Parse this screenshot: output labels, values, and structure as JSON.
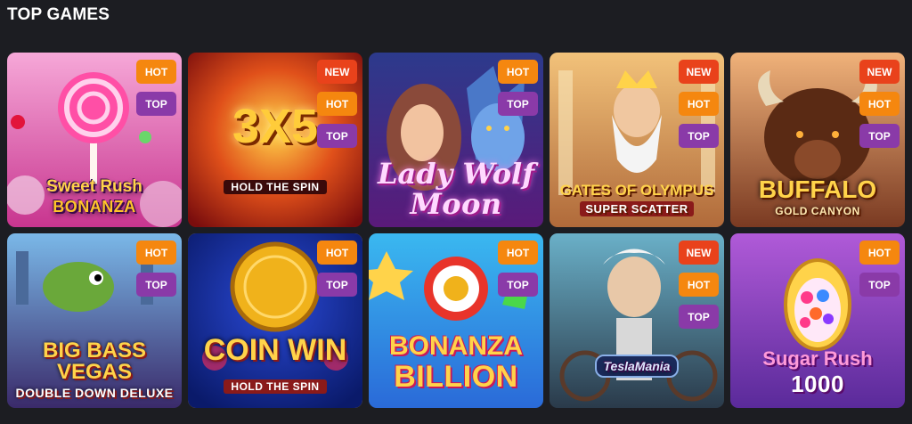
{
  "section": {
    "title": "TOP GAMES"
  },
  "colors": {
    "hot": "#f5870f",
    "new": "#e9421b",
    "top": "#8a3aa8",
    "selected_outline": "#f0b21b"
  },
  "games": [
    {
      "name": "Sweet Rush Bonanza",
      "title_line1": "Sweet Rush",
      "title_line2": "BONANZA",
      "badges": [
        "HOT",
        "TOP"
      ]
    },
    {
      "name": "3x5 Hold the Spin",
      "title_line1": "3X5",
      "title_line2": "HOLD THE SPIN",
      "badges": [
        "NEW",
        "HOT",
        "TOP"
      ]
    },
    {
      "name": "Lady Wolf Moon",
      "title_line1": "Lady Wolf",
      "title_line2": "Moon",
      "badges": [
        "HOT",
        "TOP"
      ]
    },
    {
      "name": "Gates of Olympus Super Scatter",
      "title_line1": "GATES OF OLYMPUS",
      "title_line2": "SUPER SCATTER",
      "badges": [
        "NEW",
        "HOT",
        "TOP"
      ]
    },
    {
      "name": "Buffalo Gold Canyon",
      "title_line1": "BUFFALO",
      "title_line2": "GOLD CANYON",
      "badges": [
        "NEW",
        "HOT",
        "TOP"
      ]
    },
    {
      "name": "Big Bass Vegas Double Down Deluxe",
      "title_line1": "BIG BASS VEGAS",
      "title_line2": "DOUBLE DOWN DELUXE",
      "badges": [
        "HOT",
        "TOP"
      ]
    },
    {
      "name": "Coin Win Hold the Spin",
      "title_line1": "COIN WIN",
      "title_line2": "HOLD THE SPIN",
      "badges": [
        "HOT",
        "TOP"
      ]
    },
    {
      "name": "Bonanza Billion",
      "title_line1": "BONANZA",
      "title_line2": "BILLION",
      "badges": [
        "HOT",
        "TOP"
      ]
    },
    {
      "name": "TeslaMania",
      "title_line1": "TeslaMania",
      "title_line2": "",
      "badges": [
        "NEW",
        "HOT",
        "TOP"
      ]
    },
    {
      "name": "Sugar Rush 1000",
      "title_line1": "Sugar Rush",
      "title_line2": "1000",
      "badges": [
        "HOT",
        "TOP"
      ]
    }
  ]
}
